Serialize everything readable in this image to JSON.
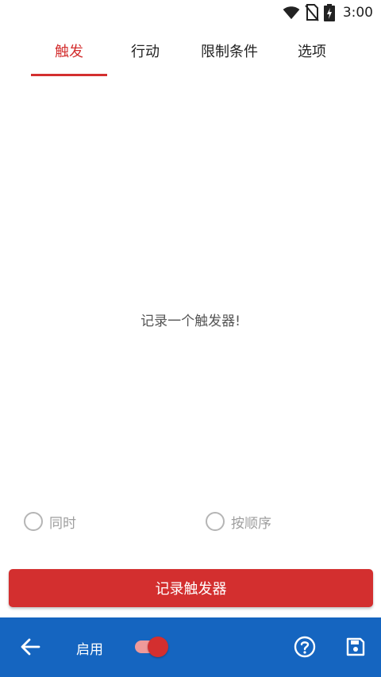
{
  "status_bar": {
    "time": "3:00",
    "icons": [
      "wifi-icon",
      "no-sim-icon",
      "battery-charging-icon"
    ]
  },
  "tabs": [
    {
      "label": "触发",
      "active": true
    },
    {
      "label": "行动",
      "active": false
    },
    {
      "label": "限制条件",
      "active": false
    },
    {
      "label": "选项",
      "active": false
    }
  ],
  "main": {
    "empty_message": "记录一个触发器!"
  },
  "trigger_mode": {
    "options": [
      {
        "label": "同时",
        "selected": false
      },
      {
        "label": "按顺序",
        "selected": false
      }
    ]
  },
  "record_button": {
    "label": "记录触发器"
  },
  "bottom_bar": {
    "back_icon": "arrow-left-icon",
    "enable_label": "启用",
    "enabled": true,
    "help_icon": "help-circle-icon",
    "save_icon": "save-icon"
  },
  "colors": {
    "accent": "#d32f2f",
    "bottom_bar": "#1565c0",
    "toggle_track": "#ef9a9a"
  }
}
